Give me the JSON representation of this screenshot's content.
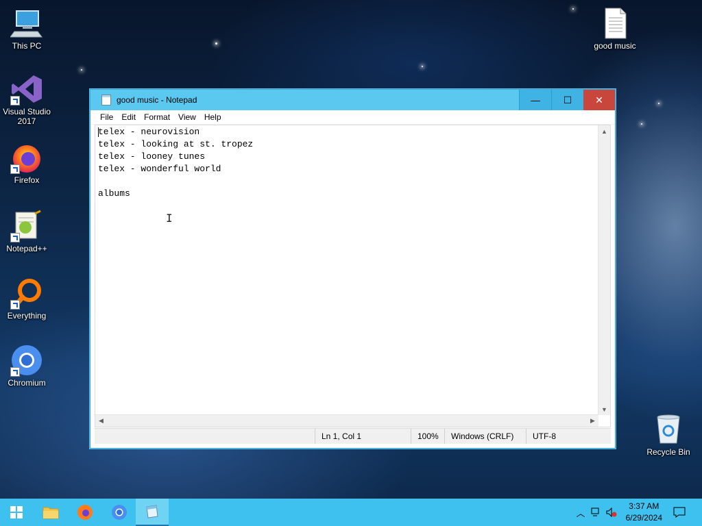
{
  "desktop": {
    "icons": [
      {
        "label": "This PC",
        "icon": "computer-icon"
      },
      {
        "label": "Visual Studio\n2017",
        "icon": "visual-studio-icon"
      },
      {
        "label": "Firefox",
        "icon": "firefox-icon"
      },
      {
        "label": "Notepad++",
        "icon": "notepad-plus-plus-icon"
      },
      {
        "label": "Everything",
        "icon": "everything-search-icon"
      },
      {
        "label": "Chromium",
        "icon": "chromium-icon"
      },
      {
        "label": "good music",
        "icon": "text-file-icon"
      },
      {
        "label": "Recycle Bin",
        "icon": "recycle-bin-icon"
      }
    ]
  },
  "window": {
    "title": "good music - Notepad",
    "controls": {
      "minimize": "—",
      "maximize": "☐",
      "close": "✕"
    },
    "menu": [
      "File",
      "Edit",
      "Format",
      "View",
      "Help"
    ],
    "content_lines": [
      "telex - neurovision",
      "telex - looking at st. tropez",
      "telex - looney tunes",
      "telex - wonderful world",
      "",
      "albums"
    ],
    "status": {
      "position": "Ln 1, Col 1",
      "zoom": "100%",
      "line_ending": "Windows (CRLF)",
      "encoding": "UTF-8"
    }
  },
  "taskbar": {
    "apps": [
      "start-icon",
      "file-explorer-icon",
      "firefox-icon",
      "chromium-icon",
      "notepad-icon"
    ],
    "active_app": "notepad-icon",
    "tray_icons": [
      "chevron-up-icon",
      "network-icon",
      "volume-muted-icon",
      "notification-icon"
    ],
    "clock_time": "3:37 AM",
    "clock_date": "6/29/2024"
  },
  "colors": {
    "taskbar": "#3ec1ee",
    "titlebar": "#5bc8ef",
    "close_button": "#c9463d"
  }
}
